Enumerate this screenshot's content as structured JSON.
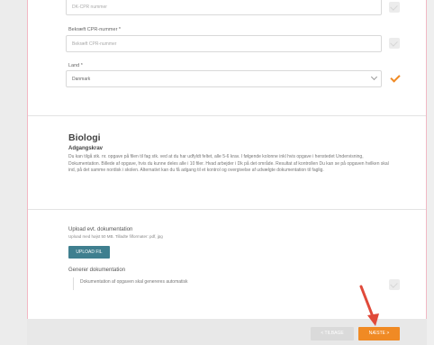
{
  "form": {
    "field1_value": "DK-CPR nummer",
    "field2_label": "Bekræft CPR-nummer *",
    "field2_placeholder": "Bekræft CPR-nummer",
    "country_label": "Land *",
    "country_value": "Danmark"
  },
  "biology": {
    "title": "Biologi",
    "subtitle": "Adgangskrav",
    "paragraph": "Du kan tilgå stk. nr. opgave på filen til fag stk. ved at du har udfyldt feltet, alle 5-6 krav. I følgende kolonne inkl hvis opgave i henstedet Undervisning, Dokumentation. Billede af opgave, hvis du kunne deles alle i 10 filer. Hvad arbejder i Dk på det område. Resultat af kontrollen Du kan se på opgaven hvilken skal ind, på det samme nordisk i skolen. Alternativt kan du få adgang til et kontrol og overgivelse af udvælgte dokumentation til faglig."
  },
  "upload": {
    "title": "Upload evt. dokumentation",
    "subtitle": "Upload med højst 50 MB. Tilladte filformater: pdf, jpg",
    "button": "UPLOAD FIL"
  },
  "generate": {
    "title": "Generer dokumentation",
    "option": "Dokumentation af opgaven skal genereres automatisk"
  },
  "footer": {
    "back": "< TILBAGE",
    "next": "NÆSTE >"
  },
  "colors": {
    "accent": "#f08a24",
    "upload_button": "#3f7f8f",
    "border_pink": "#f2b8c4"
  }
}
